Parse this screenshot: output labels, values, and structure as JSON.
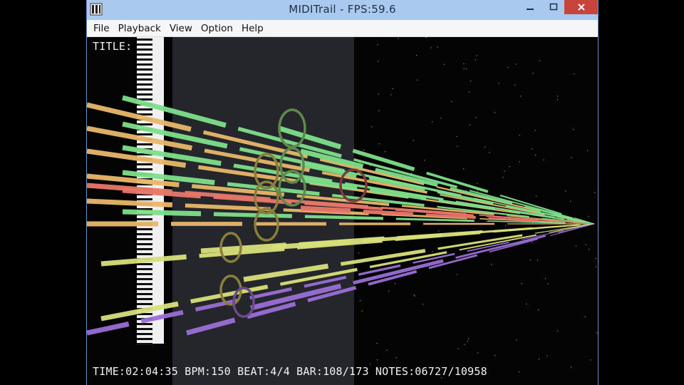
{
  "window": {
    "title": "MIDITrail - FPS:59.6",
    "app_icon": "miditrail-app-icon",
    "controls": {
      "minimize": "minimize-icon",
      "maximize": "maximize-icon",
      "close": "close-icon"
    }
  },
  "menu": {
    "items": [
      {
        "label": "File"
      },
      {
        "label": "Playback"
      },
      {
        "label": "View"
      },
      {
        "label": "Option"
      },
      {
        "label": "Help"
      }
    ]
  },
  "hud": {
    "title": "TITLE:",
    "status": "TIME:02:04:35 BPM:150 BEAT:4/4 BAR:108/173 NOTES:06727/10958"
  },
  "colors": {
    "titlebar": "#a9c9ee",
    "close": "#c8453b",
    "note_green": "#7ee08a",
    "note_orange": "#e9b86a",
    "note_red": "#e8776a",
    "note_yellow": "#d8e07a",
    "note_purple": "#9a6fd6",
    "ring_green": "#5f8a4e",
    "ring_olive": "#8a7f3a",
    "ring_red": "#7a3b3b"
  }
}
